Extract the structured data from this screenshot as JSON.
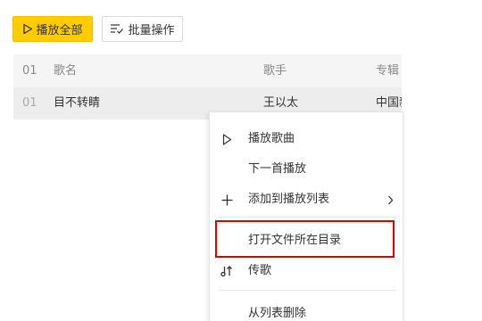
{
  "toolbar": {
    "play_all_label": "播放全部",
    "batch_label": "批量操作"
  },
  "table": {
    "header": {
      "index": "01",
      "name": "歌名",
      "artist": "歌手",
      "album": "专辑"
    },
    "rows": [
      {
        "index": "01",
        "name": "目不转睛",
        "artist": "王以太",
        "album": "中国新"
      }
    ]
  },
  "context_menu": {
    "items": [
      {
        "label": "播放歌曲",
        "icon": "play-icon"
      },
      {
        "label": "下一首播放",
        "icon": ""
      },
      {
        "label": "添加到播放列表",
        "icon": "plus-icon",
        "has_submenu": true
      },
      {
        "label": "打开文件所在目录",
        "icon": ""
      },
      {
        "label": "传歌",
        "icon": "transfer-song-icon"
      },
      {
        "label": "从列表删除",
        "icon": ""
      }
    ]
  },
  "colors": {
    "accent": "#ffcc00",
    "highlight": "#e60000"
  }
}
